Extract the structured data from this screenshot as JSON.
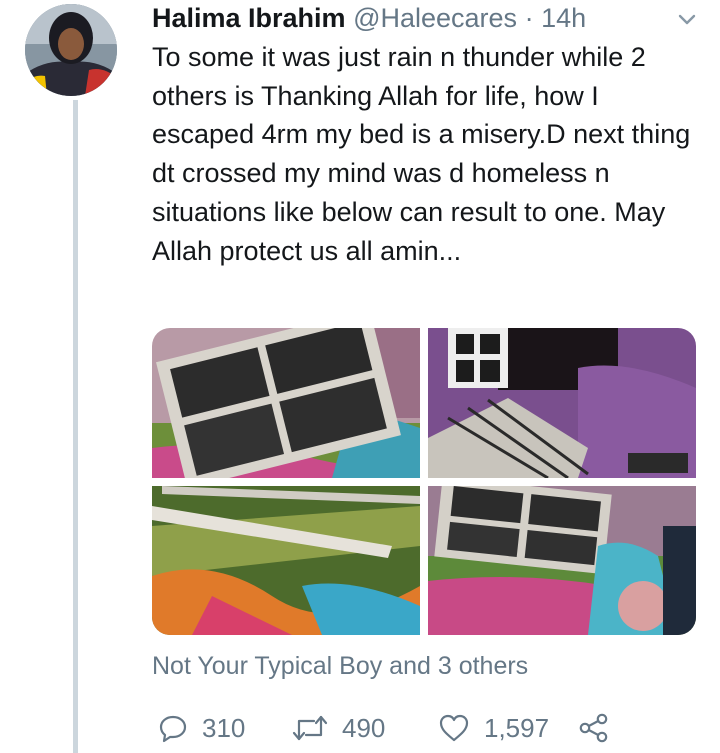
{
  "tweet": {
    "author_name": "Halima Ibrahim",
    "author_handle": "@Haleecares",
    "separator": "·",
    "time": "14h",
    "text": "To some it was just rain n thunder while 2 others is Thanking Allah for life, how I escaped 4rm my bed is a misery.D next thing dt crossed my mind was d homeless n situations like below can result to one. May Allah protect us all amin...",
    "liked_by": "Not Your Typical Boy and 3 others",
    "stats": {
      "replies": "310",
      "retweets": "490",
      "likes": "1,597"
    },
    "media_count": 4
  },
  "icons": [
    "chevron-down-icon",
    "reply-icon",
    "retweet-icon",
    "like-icon",
    "share-icon"
  ],
  "colors": {
    "text": "#14171a",
    "secondary": "#657786",
    "thread_line": "#ccd6dd"
  }
}
